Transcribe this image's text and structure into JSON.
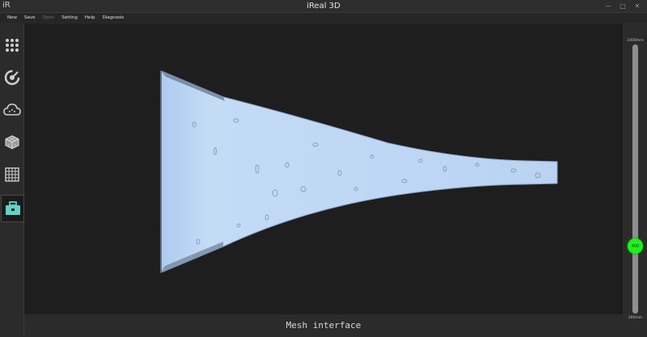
{
  "window": {
    "logo": "iR",
    "title": "iReal 3D",
    "controls": {
      "minimize": "—",
      "maximize": "□",
      "close": "✕"
    }
  },
  "menu": [
    {
      "label": "New",
      "enabled": true
    },
    {
      "label": "Save",
      "enabled": true
    },
    {
      "label": "Open",
      "enabled": false
    },
    {
      "label": "Setting",
      "enabled": true
    },
    {
      "label": "Help",
      "enabled": true
    },
    {
      "label": "Diagnosis",
      "enabled": true
    }
  ],
  "sidebar": {
    "items": [
      {
        "icon": "grid-dots-icon",
        "active": false
      },
      {
        "icon": "scan-target-icon",
        "active": false
      },
      {
        "icon": "cloud-icon",
        "active": false
      },
      {
        "icon": "mesh-cube-icon",
        "active": false
      },
      {
        "icon": "mesh-grid-icon",
        "active": false
      },
      {
        "icon": "toolbox-icon",
        "active": true
      }
    ]
  },
  "status": {
    "text": "Mesh interface"
  },
  "slider": {
    "max_label": "1000mm",
    "min_label": "200mm",
    "value_label": "400",
    "value_fraction": 0.25
  },
  "colors": {
    "mesh": "#bcd6f4",
    "accent": "#5fd3c8",
    "slider_thumb": "#1ef01e"
  }
}
